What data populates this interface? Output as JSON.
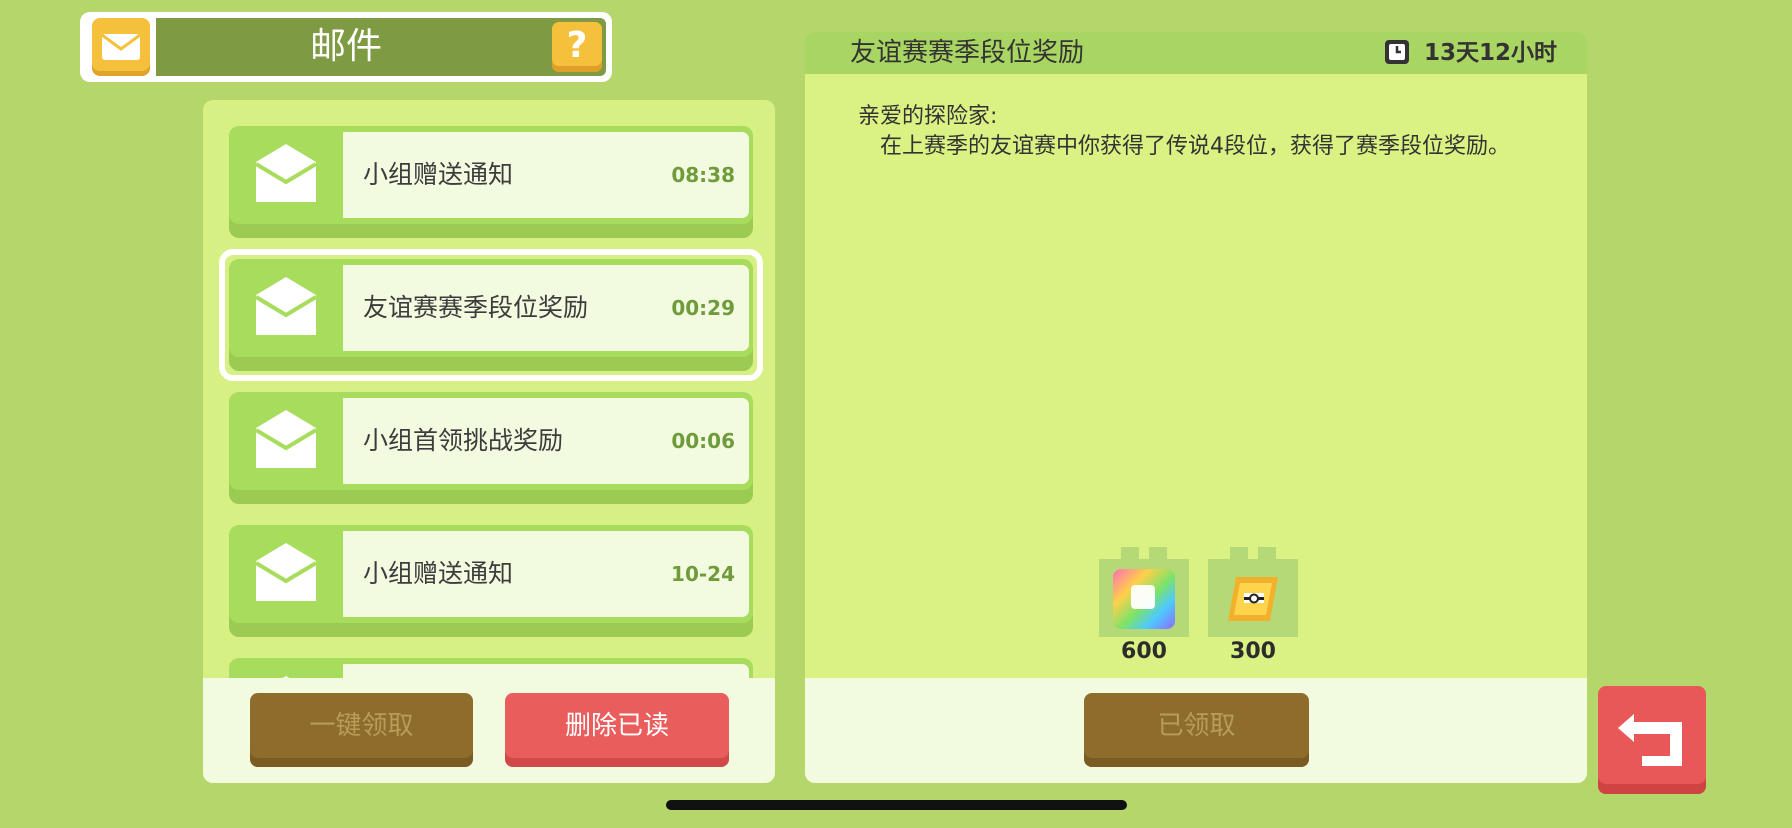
{
  "header": {
    "title": "邮件",
    "help_label": "?"
  },
  "mail_list": [
    {
      "title": "小组赠送通知",
      "time": "08:38",
      "selected": false
    },
    {
      "title": "友谊赛赛季段位奖励",
      "time": "00:29",
      "selected": true
    },
    {
      "title": "小组首领挑战奖励",
      "time": "00:06",
      "selected": false
    },
    {
      "title": "小组赠送通知",
      "time": "10-24",
      "selected": false
    }
  ],
  "left_footer": {
    "claim_all_label": "一键领取",
    "delete_read_label": "删除已读"
  },
  "detail": {
    "title": "友谊赛赛季段位奖励",
    "expiry": "13天12小时",
    "greeting": "亲爱的探险家:",
    "body": "在上赛季的友谊赛中你获得了传说4段位，获得了赛季段位奖励。",
    "rewards": [
      {
        "icon": "rainbow-cube-icon",
        "count": "600"
      },
      {
        "icon": "ticket-icon",
        "count": "300"
      }
    ],
    "claimed_label": "已领取"
  },
  "colors": {
    "background": "#b5d66b",
    "panel": "#d7f084",
    "accent_yellow": "#f5c03c",
    "button_red": "#ea5d5d",
    "button_brown": "#8e6c2c"
  }
}
